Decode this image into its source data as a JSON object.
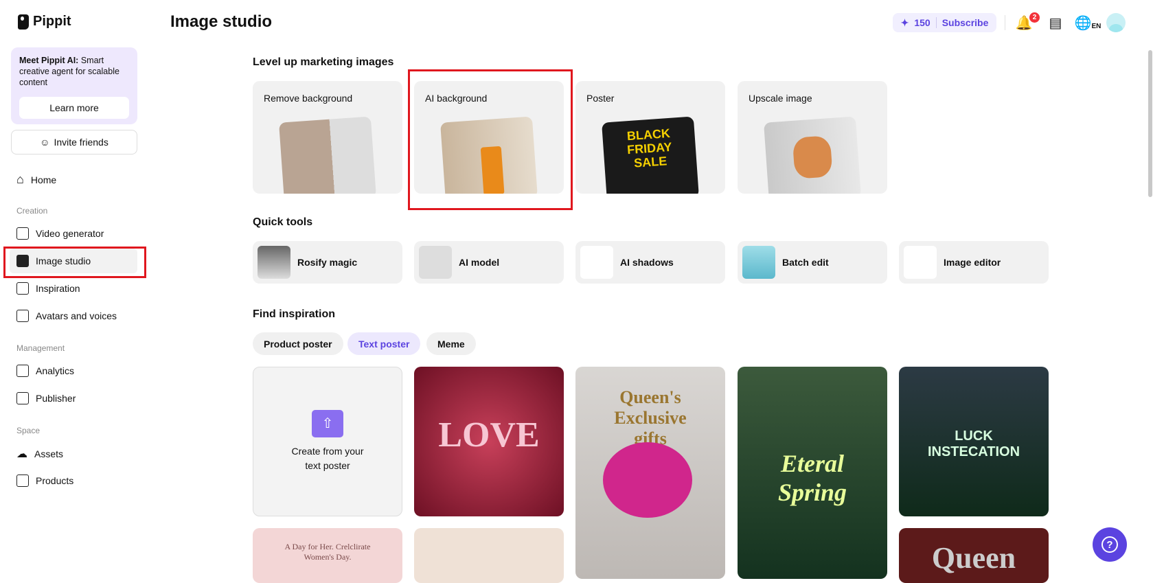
{
  "app": {
    "name": "Pippit",
    "page_title": "Image studio"
  },
  "promo": {
    "bold": "Meet Pippit AI:",
    "text": " Smart creative agent for scalable content",
    "button": "Learn more"
  },
  "invite": "Invite friends",
  "nav": {
    "home": "Home",
    "creation_label": "Creation",
    "video": "Video generator",
    "image_studio": "Image studio",
    "inspiration": "Inspiration",
    "avatars": "Avatars and voices",
    "management_label": "Management",
    "analytics": "Analytics",
    "publisher": "Publisher",
    "space_label": "Space",
    "assets": "Assets",
    "products": "Products"
  },
  "header": {
    "credits": "150",
    "subscribe": "Subscribe",
    "notifications": "2",
    "language": "EN"
  },
  "level_up": {
    "title": "Level up marketing images",
    "cards": [
      "Remove background",
      "AI background",
      "Poster",
      "Upscale image"
    ],
    "poster_text": "BLACK FRIDAY SALE"
  },
  "quick_tools": {
    "title": "Quick tools",
    "items": [
      "Rosify magic",
      "AI model",
      "AI shadows",
      "Batch edit",
      "Image editor"
    ]
  },
  "inspiration": {
    "title": "Find inspiration",
    "chips": [
      "Product poster",
      "Text poster",
      "Meme"
    ],
    "create": "Create from your text poster",
    "tiles": [
      "LOVE",
      "Queen's Exclusive gifts",
      "Eteral Spring",
      "LUCK INSTECATION",
      "A Day for Her. Crelclirate Women's Day.",
      "Queen"
    ]
  },
  "colors": {
    "accent": "#5b43e0",
    "highlight": "#e0171e"
  }
}
